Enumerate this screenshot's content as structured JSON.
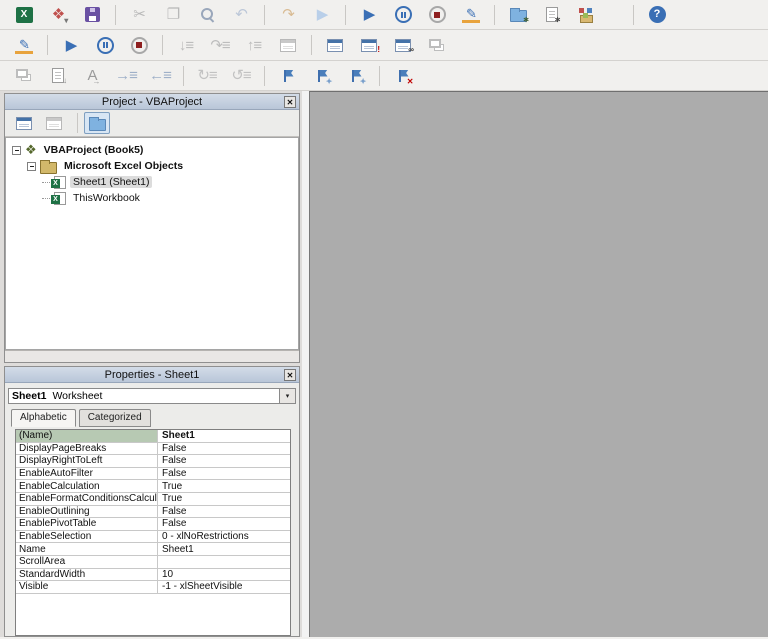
{
  "icons": {
    "close": "✕",
    "dropdown": "▾"
  },
  "toolbars": {
    "standard": [
      {
        "name": "view-excel",
        "cls": "excel",
        "glyph": "X"
      },
      {
        "name": "insert-userform",
        "glyph": "❖",
        "color": "#c0504d",
        "glyph2": "▾",
        "color2": "#777"
      },
      {
        "name": "save",
        "cls": "floppy"
      },
      {
        "sep": true
      },
      {
        "name": "cut",
        "glyph": "✂",
        "color": "#b8b8b8",
        "disabled": true
      },
      {
        "name": "paste",
        "glyph": "❐",
        "color": "#b8b8b8",
        "disabled": true
      },
      {
        "name": "find",
        "cls": "mag"
      },
      {
        "name": "undo",
        "glyph": "↶",
        "color": "#bcc7d8",
        "disabled": true
      },
      {
        "sep": true
      },
      {
        "name": "redo",
        "glyph": "↷",
        "color": "#d9bb93",
        "disabled": true
      },
      {
        "name": "run-sub",
        "glyph": "▶",
        "color": "#b9cfe9",
        "disabled": true
      },
      {
        "sep": true
      },
      {
        "name": "run",
        "glyph": "▶",
        "color": "#3a6fb5"
      },
      {
        "name": "break",
        "cls": "pausec"
      },
      {
        "name": "reset",
        "cls": "stopc"
      },
      {
        "name": "design-mode",
        "cls": "design",
        "glyph": "✎",
        "color": "#3a6fb5"
      },
      {
        "sep": true
      },
      {
        "name": "project-explorer",
        "cls": "folderic",
        "glyph2": "∗",
        "color2": "#3f5d2e"
      },
      {
        "name": "properties-window",
        "cls": "page",
        "glyph2": "∗",
        "color2": "#444"
      },
      {
        "name": "object-browser",
        "cls": "cubes"
      },
      {
        "sep": true,
        "wide": true
      },
      {
        "name": "help",
        "cls": "helpc",
        "glyph": "?"
      }
    ],
    "debug": [
      {
        "name": "design-mode",
        "cls": "design",
        "glyph": "✎",
        "color": "#3a6fb5"
      },
      {
        "sep": true
      },
      {
        "name": "run",
        "glyph": "▶",
        "color": "#3a6fb5"
      },
      {
        "name": "break",
        "cls": "pausec"
      },
      {
        "name": "reset",
        "cls": "stopc"
      },
      {
        "sep": true
      },
      {
        "name": "step-into",
        "glyph": "↓≡",
        "color": "#bdbdbd",
        "disabled": true
      },
      {
        "name": "step-over",
        "glyph": "↷≡",
        "color": "#bdbdbd",
        "disabled": true
      },
      {
        "name": "step-out",
        "glyph": "↑≡",
        "color": "#bdbdbd",
        "disabled": true
      },
      {
        "name": "call-stack",
        "cls": "win gray",
        "disabled": true
      },
      {
        "sep": true
      },
      {
        "name": "locals-window",
        "cls": "win"
      },
      {
        "name": "immediate-window",
        "cls": "win",
        "glyph2": "!",
        "color2": "#c00000"
      },
      {
        "name": "watch-window",
        "cls": "win",
        "glyph2": "∞",
        "color2": "#333"
      },
      {
        "name": "quick-watch",
        "cls": "stack",
        "disabled": true
      }
    ],
    "edit": [
      {
        "name": "list-properties",
        "cls": "stack",
        "disabled": true
      },
      {
        "name": "list-constants",
        "cls": "page",
        "glyph2": "↓",
        "color2": "#8a8a8a",
        "disabled": true
      },
      {
        "name": "complete-word",
        "glyph": "A",
        "color": "#9a9a9a",
        "glyph2": "→",
        "color2": "#9a9a9a",
        "disabled": true
      },
      {
        "name": "indent",
        "glyph": "→≡",
        "color": "#9fb0c8",
        "disabled": true
      },
      {
        "name": "outdent",
        "glyph": "←≡",
        "color": "#9fb0c8",
        "disabled": true
      },
      {
        "sep": true
      },
      {
        "name": "comment-block",
        "glyph": "↻≡",
        "color": "#c2c2c2",
        "disabled": true
      },
      {
        "name": "uncomment-block",
        "glyph": "↺≡",
        "color": "#c2c2c2",
        "disabled": true
      },
      {
        "sep": true
      },
      {
        "name": "toggle-bookmark",
        "cls": "flag"
      },
      {
        "name": "next-bookmark",
        "cls": "flag",
        "glyph2": "✦",
        "color2": "#7aa0cc"
      },
      {
        "name": "previous-bookmark",
        "cls": "flag",
        "glyph2": "✦",
        "color2": "#7aa0cc"
      },
      {
        "sep": true
      },
      {
        "name": "clear-bookmarks",
        "cls": "flag",
        "glyph2": "✕",
        "color2": "#c00000"
      }
    ]
  },
  "project_panel": {
    "title": "Project - VBAProject",
    "buttons": [
      {
        "name": "view-code",
        "cls": "win"
      },
      {
        "name": "view-object",
        "cls": "win gray"
      },
      {
        "sep": true
      },
      {
        "name": "toggle-folders",
        "cls": "folderic",
        "pressed": true
      }
    ],
    "tree": [
      {
        "label": "VBAProject (Book5)",
        "level": 0,
        "expander": true,
        "icon": "project",
        "glyph": "❖",
        "color": "#55682c",
        "bold": true
      },
      {
        "label": "Microsoft Excel Objects",
        "level": 1,
        "expander": true,
        "icon": "excel-objects-folder",
        "cls": "folderic tan",
        "bold": true
      },
      {
        "label": "Sheet1 (Sheet1)",
        "level": 2,
        "icon": "worksheet",
        "cls": "sheet",
        "selected": true
      },
      {
        "label": "ThisWorkbook",
        "level": 2,
        "icon": "workbook",
        "cls": "sheet"
      }
    ]
  },
  "properties_panel": {
    "title": "Properties - Sheet1",
    "selector": {
      "object": "Sheet1",
      "type": "Worksheet"
    },
    "tabs": [
      {
        "label": "Alphabetic",
        "active": true
      },
      {
        "label": "Categorized",
        "active": false
      }
    ],
    "rows": [
      {
        "name": "(Name)",
        "value": "Sheet1",
        "selected": true
      },
      {
        "name": "DisplayPageBreaks",
        "value": "False"
      },
      {
        "name": "DisplayRightToLeft",
        "value": "False"
      },
      {
        "name": "EnableAutoFilter",
        "value": "False"
      },
      {
        "name": "EnableCalculation",
        "value": "True"
      },
      {
        "name": "EnableFormatConditionsCalculation",
        "value": "True"
      },
      {
        "name": "EnableOutlining",
        "value": "False"
      },
      {
        "name": "EnablePivotTable",
        "value": "False"
      },
      {
        "name": "EnableSelection",
        "value": "0 - xlNoRestrictions"
      },
      {
        "name": "Name",
        "value": "Sheet1"
      },
      {
        "name": "ScrollArea",
        "value": ""
      },
      {
        "name": "StandardWidth",
        "value": "10"
      },
      {
        "name": "Visible",
        "value": "-1 - xlSheetVisible"
      }
    ]
  }
}
